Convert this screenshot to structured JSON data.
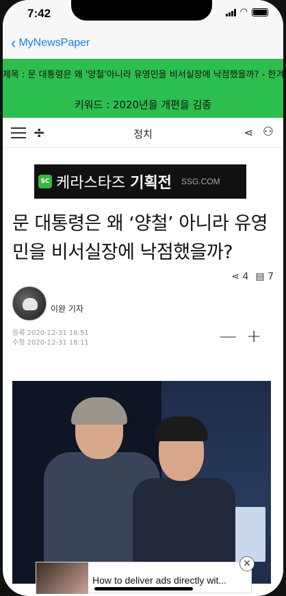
{
  "status_bar": {
    "time": "7:42"
  },
  "nav": {
    "back_label": "MyNewsPaper"
  },
  "banner": {
    "title_line": "제목 : 문 대통령은 왜 '양철'아니라 유영민을 비서실장에 낙점했을까? - 한겨레",
    "keywords_line": "키워드 : 2020년을   개편을   김종"
  },
  "section": {
    "title": "정치"
  },
  "ad": {
    "logo": "SC",
    "text_light": "케라스타즈 ",
    "text_bold": "기획전",
    "sub": "SSG.COM"
  },
  "article": {
    "headline": "문 대통령은 왜 ‘양철’ 아니라 유영민을 비서실장에 낙점했을까?",
    "share_count": "4",
    "comment_count": "7",
    "author": "이완 기자",
    "registered": "등록 2020-12-31 16:51",
    "modified": "수정 2020-12-31 18:11"
  },
  "bottom_ad": {
    "text": "How to deliver ads directly wit..."
  }
}
